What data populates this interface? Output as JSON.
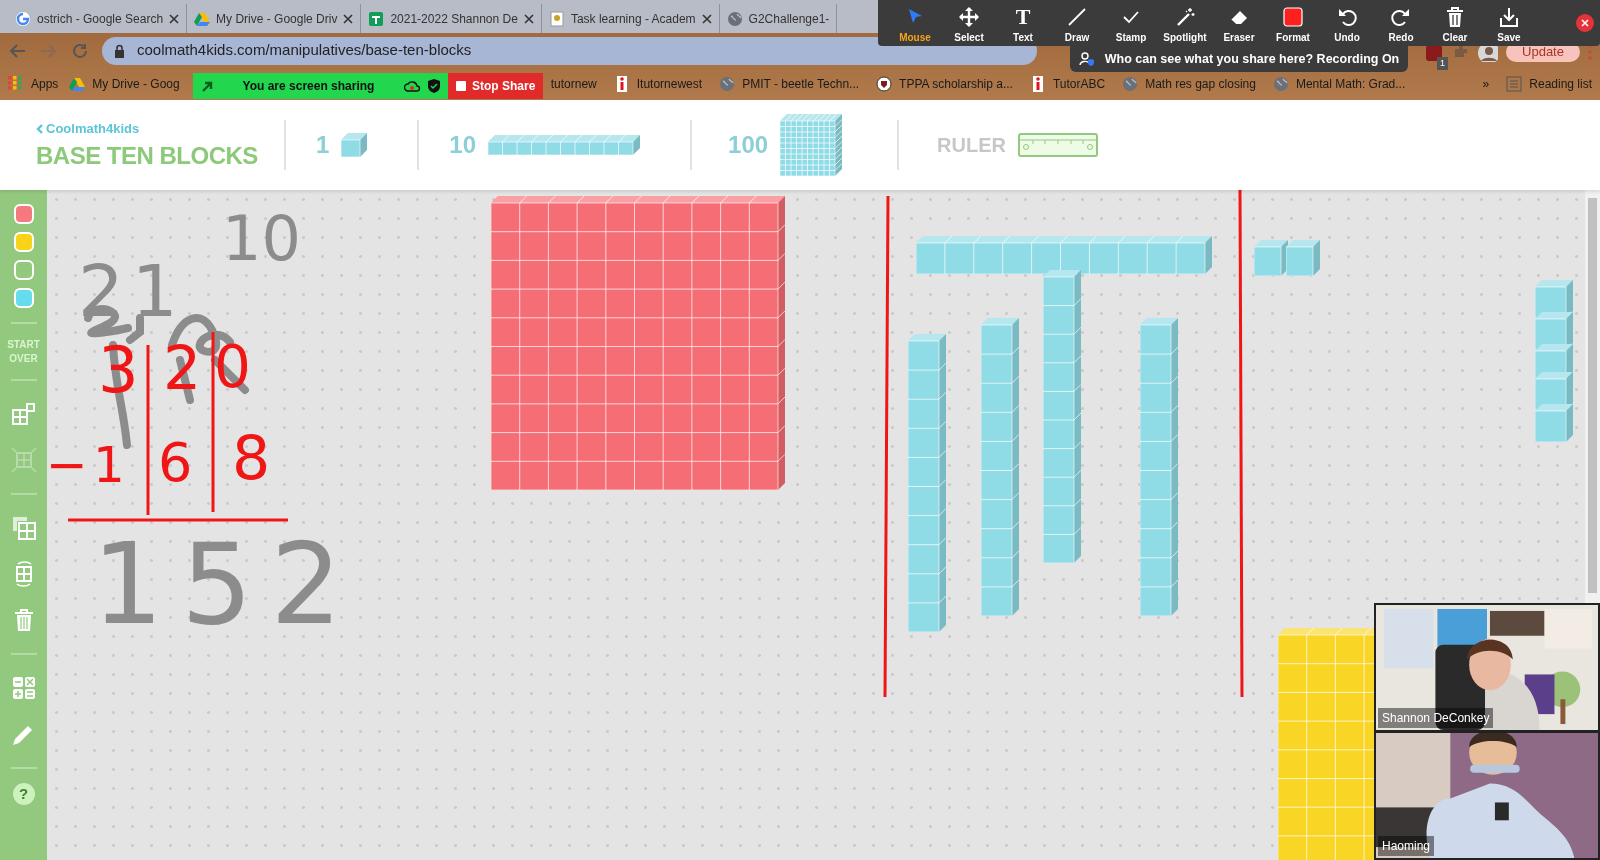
{
  "browser": {
    "tabs": [
      {
        "title": "ostrich - Google Search",
        "kind": "search"
      },
      {
        "title": "My Drive - Google Driv",
        "kind": "drive"
      },
      {
        "title": "2021-2022 Shannon De",
        "kind": "sheet"
      },
      {
        "title": "Task learning - Academ",
        "kind": "doc"
      },
      {
        "title": "G2Challenge1-",
        "kind": "globe"
      }
    ],
    "url": "coolmath4kids.com/manipulatives/base-ten-blocks",
    "extension_badge": "1",
    "update_button": "Update",
    "bookmarks": [
      {
        "label": "Apps",
        "kind": "apps"
      },
      {
        "label": "My Drive - Goog",
        "kind": "drive"
      },
      {
        "label": "tutornew",
        "kind": "none"
      },
      {
        "label": "Itutornewest",
        "kind": "info"
      },
      {
        "label": "PMIT - beetle Techn...",
        "kind": "globe"
      },
      {
        "label": "TPPA scholarship a...",
        "kind": "crest"
      },
      {
        "label": "TutorABC",
        "kind": "info"
      },
      {
        "label": "Math res gap closing",
        "kind": "globe"
      },
      {
        "label": "Mental Math: Grad...",
        "kind": "globe"
      }
    ],
    "more_bookmarks": "»",
    "reading_list": "Reading list"
  },
  "share_banner": {
    "message": "You are screen sharing",
    "stop_label": "Stop Share"
  },
  "annotation_toolbar": {
    "tools": [
      {
        "label": "Mouse",
        "kind": "mouse",
        "selected": true
      },
      {
        "label": "Select",
        "kind": "select",
        "selected": false
      },
      {
        "label": "Text",
        "kind": "text",
        "glyph": "T",
        "selected": false
      },
      {
        "label": "Draw",
        "kind": "draw",
        "selected": false
      },
      {
        "label": "Stamp",
        "kind": "stamp",
        "selected": false
      },
      {
        "label": "Spotlight",
        "kind": "spotlight",
        "selected": false
      },
      {
        "label": "Eraser",
        "kind": "eraser",
        "selected": false
      },
      {
        "label": "Format",
        "kind": "format",
        "selected": false
      },
      {
        "label": "Undo",
        "kind": "undo",
        "selected": false
      },
      {
        "label": "Redo",
        "kind": "redo",
        "selected": false
      },
      {
        "label": "Clear",
        "kind": "clear",
        "selected": false
      },
      {
        "label": "Save",
        "kind": "save",
        "selected": false
      }
    ],
    "notice": "Who can see what you share here? Recording On"
  },
  "app": {
    "logo": "Coolmath4kids",
    "title": "BASE TEN BLOCKS",
    "blocks": [
      {
        "label": "1",
        "kind": "unit"
      },
      {
        "label": "10",
        "kind": "rod"
      },
      {
        "label": "100",
        "kind": "flat"
      },
      {
        "label": "RULER",
        "kind": "ruler"
      }
    ]
  },
  "sidebar": {
    "colors": [
      {
        "color": "#f47a80"
      },
      {
        "color": "#f9d21a"
      },
      {
        "color": "#93c97f"
      },
      {
        "color": "#67dcec"
      }
    ],
    "start_over": "START OVER",
    "tools": [
      {
        "kind": "arrange",
        "disabled": false
      },
      {
        "kind": "collapse",
        "disabled": true
      },
      {
        "kind": "copy",
        "disabled": false
      },
      {
        "kind": "rotate",
        "disabled": false
      },
      {
        "kind": "trash",
        "disabled": false
      },
      {
        "kind": "calculator",
        "disabled": false
      },
      {
        "kind": "pencil",
        "disabled": false
      }
    ],
    "help": "?"
  },
  "canvas": {
    "pieces": [
      {
        "kind": "flat",
        "color": "#f66e75"
      },
      {
        "kind": "rod",
        "color": "#8fdbe6"
      },
      {
        "kind": "rod",
        "color": "#8fdbe6"
      },
      {
        "kind": "rod",
        "color": "#8fdbe6"
      },
      {
        "kind": "rod",
        "color": "#8fdbe6"
      },
      {
        "kind": "rod",
        "color": "#8fdbe6"
      },
      {
        "kind": "unit",
        "color": "#8fdbe6"
      },
      {
        "kind": "unit",
        "color": "#8fdbe6"
      },
      {
        "kind": "unit",
        "color": "#8fdbe6"
      },
      {
        "kind": "unit",
        "color": "#8fdbe6"
      },
      {
        "kind": "unit",
        "color": "#8fdbe6"
      },
      {
        "kind": "unit",
        "color": "#8fdbe6"
      },
      {
        "kind": "unit",
        "color": "#8fdbe6"
      },
      {
        "kind": "flat",
        "color": "#f9d626"
      }
    ],
    "ink": [
      {
        "text": "21",
        "color": "#8c8c8c"
      },
      {
        "text": "10",
        "color": "#8c8c8c"
      },
      {
        "text": "3",
        "color": "#f01616"
      },
      {
        "text": "2",
        "color": "#f01616"
      },
      {
        "text": "0",
        "color": "#f01616"
      },
      {
        "text": "−",
        "color": "#f01616"
      },
      {
        "text": "1",
        "color": "#f01616"
      },
      {
        "text": "6",
        "color": "#f01616"
      },
      {
        "text": "8",
        "color": "#f01616"
      },
      {
        "text": "152",
        "color": "#8c8c8c"
      }
    ]
  },
  "participants": [
    {
      "name": "Shannon DeConkey"
    },
    {
      "name": "Haoming"
    }
  ]
}
